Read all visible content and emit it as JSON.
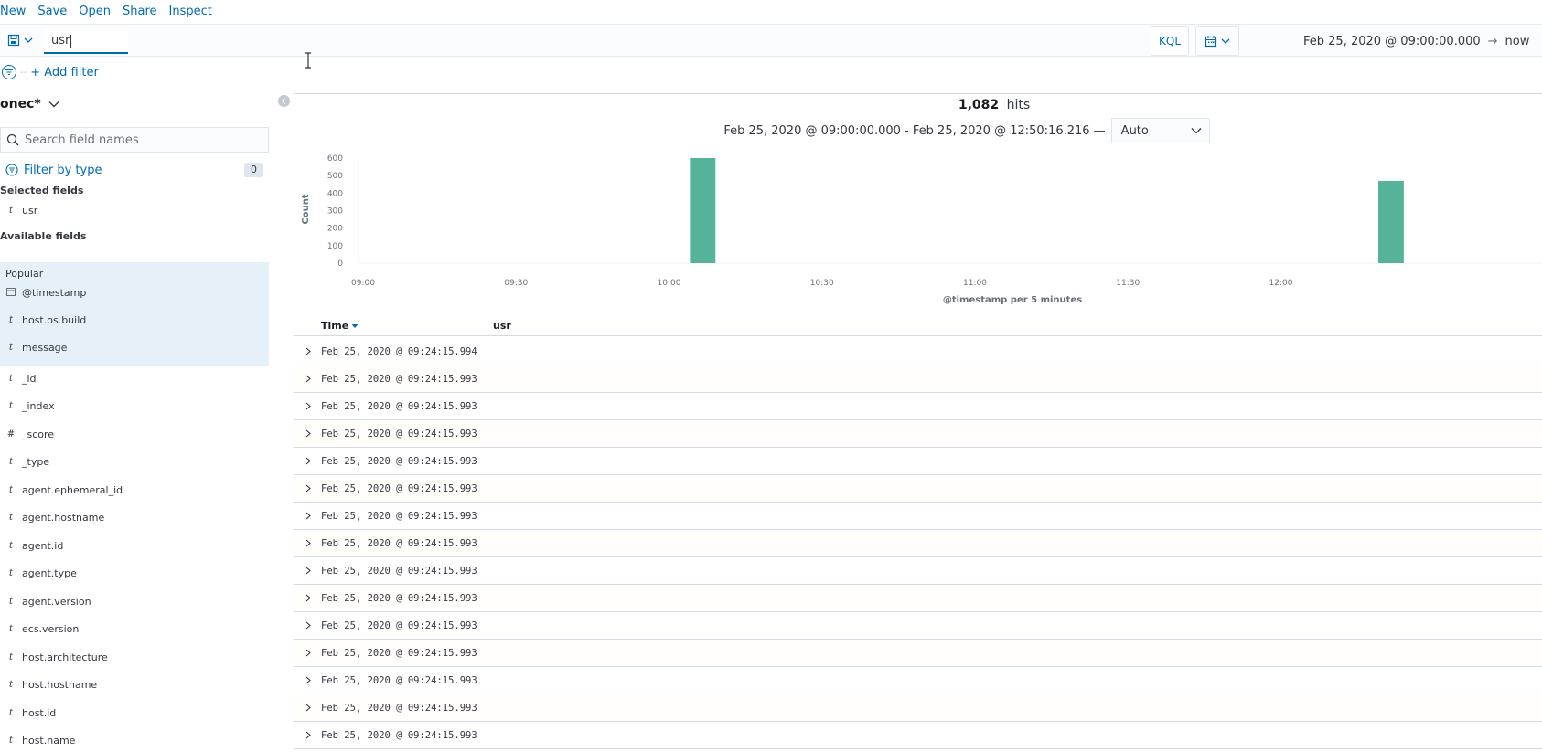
{
  "topnav": {
    "items": [
      "New",
      "Save",
      "Open",
      "Share",
      "Inspect"
    ]
  },
  "querybar": {
    "query_value": "usr",
    "language": "KQL"
  },
  "datepicker": {
    "start": "Feb 25, 2020 @ 09:00:00.000",
    "arrow": "→",
    "end": "now"
  },
  "filters": {
    "add_label": "+ Add filter",
    "separator": "--"
  },
  "sidebar": {
    "index_pattern": "onec*",
    "search_placeholder": "Search field names",
    "filter_by_type": "Filter by type",
    "filter_count": "0",
    "selected_heading": "Selected fields",
    "selected_fields": [
      {
        "type": "t",
        "name": "usr"
      }
    ],
    "available_heading": "Available fields",
    "popular_label": "Popular",
    "popular_fields": [
      {
        "type": "date",
        "name": "@timestamp"
      },
      {
        "type": "t",
        "name": "host.os.build"
      },
      {
        "type": "t",
        "name": "message"
      }
    ],
    "fields": [
      {
        "type": "t",
        "name": "_id"
      },
      {
        "type": "t",
        "name": "_index"
      },
      {
        "type": "#",
        "name": "_score"
      },
      {
        "type": "t",
        "name": "_type"
      },
      {
        "type": "t",
        "name": "agent.ephemeral_id"
      },
      {
        "type": "t",
        "name": "agent.hostname"
      },
      {
        "type": "t",
        "name": "agent.id"
      },
      {
        "type": "t",
        "name": "agent.type"
      },
      {
        "type": "t",
        "name": "agent.version"
      },
      {
        "type": "t",
        "name": "ecs.version"
      },
      {
        "type": "t",
        "name": "host.architecture"
      },
      {
        "type": "t",
        "name": "host.hostname"
      },
      {
        "type": "t",
        "name": "host.id"
      },
      {
        "type": "t",
        "name": "host.name"
      }
    ]
  },
  "main": {
    "hits_count": "1,082",
    "hits_label": "hits",
    "range_text": "Feb 25, 2020 @ 09:00:00.000 - Feb 25, 2020 @ 12:50:16.216 —",
    "interval_value": "Auto",
    "table": {
      "col_time": "Time",
      "col_usr": "usr",
      "rows": [
        "Feb 25, 2020 @ 09:24:15.994",
        "Feb 25, 2020 @ 09:24:15.993",
        "Feb 25, 2020 @ 09:24:15.993",
        "Feb 25, 2020 @ 09:24:15.993",
        "Feb 25, 2020 @ 09:24:15.993",
        "Feb 25, 2020 @ 09:24:15.993",
        "Feb 25, 2020 @ 09:24:15.993",
        "Feb 25, 2020 @ 09:24:15.993",
        "Feb 25, 2020 @ 09:24:15.993",
        "Feb 25, 2020 @ 09:24:15.993",
        "Feb 25, 2020 @ 09:24:15.993",
        "Feb 25, 2020 @ 09:24:15.993",
        "Feb 25, 2020 @ 09:24:15.993",
        "Feb 25, 2020 @ 09:24:15.993",
        "Feb 25, 2020 @ 09:24:15.993"
      ]
    }
  },
  "chart_data": {
    "type": "bar",
    "title": "",
    "xlabel": "@timestamp per 5 minutes",
    "ylabel": "Count",
    "ylim": [
      0,
      600
    ],
    "yticks": [
      0,
      100,
      200,
      300,
      400,
      500,
      600
    ],
    "xticks": [
      "09:00",
      "09:30",
      "10:00",
      "10:30",
      "11:00",
      "11:30",
      "12:00"
    ],
    "x_range_minutes": [
      0,
      220
    ],
    "bars": [
      {
        "start_minutes": 65,
        "value": 600
      },
      {
        "start_minutes": 200,
        "value": 470
      }
    ],
    "bar_width_minutes": 5,
    "color": "#54b399",
    "grid": false
  }
}
